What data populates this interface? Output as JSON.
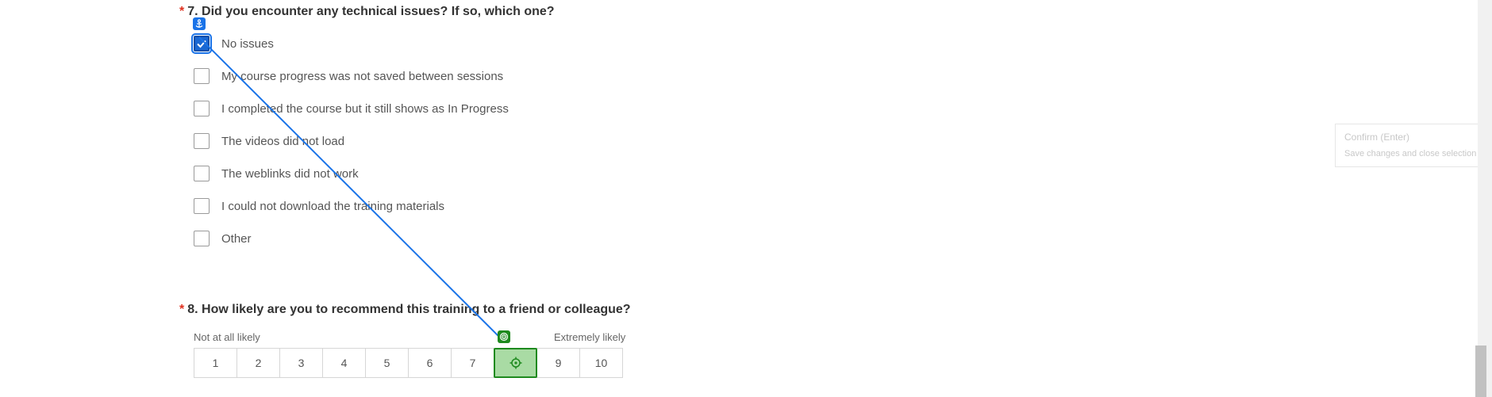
{
  "question7": {
    "required_mark": "*",
    "title": "7. Did you encounter any technical issues? If so, which one?",
    "options": [
      {
        "label": "No issues",
        "checked": true
      },
      {
        "label": "My course progress was not saved between sessions",
        "checked": false
      },
      {
        "label": "I completed the course but it still shows as In Progress",
        "checked": false
      },
      {
        "label": "The videos did not load",
        "checked": false
      },
      {
        "label": "The weblinks did not work",
        "checked": false
      },
      {
        "label": "I could not download the training materials",
        "checked": false
      },
      {
        "label": "Other",
        "checked": false
      }
    ]
  },
  "question8": {
    "required_mark": "*",
    "title": "8. How likely are you to recommend this training to a friend or colleague?",
    "low_label": "Not at all likely",
    "high_label": "Extremely likely",
    "scale": [
      "1",
      "2",
      "3",
      "4",
      "5",
      "6",
      "7",
      "8",
      "9",
      "10"
    ],
    "highlighted_value": "8"
  },
  "tooltip": {
    "title": "Confirm (Enter)",
    "subtitle": "Save changes and close selection w"
  },
  "overlay": {
    "anchor_icon": "anchor-icon",
    "target_icon": "target-icon",
    "line_color": "#1a73e8",
    "target_color": "#1e8a1e"
  }
}
